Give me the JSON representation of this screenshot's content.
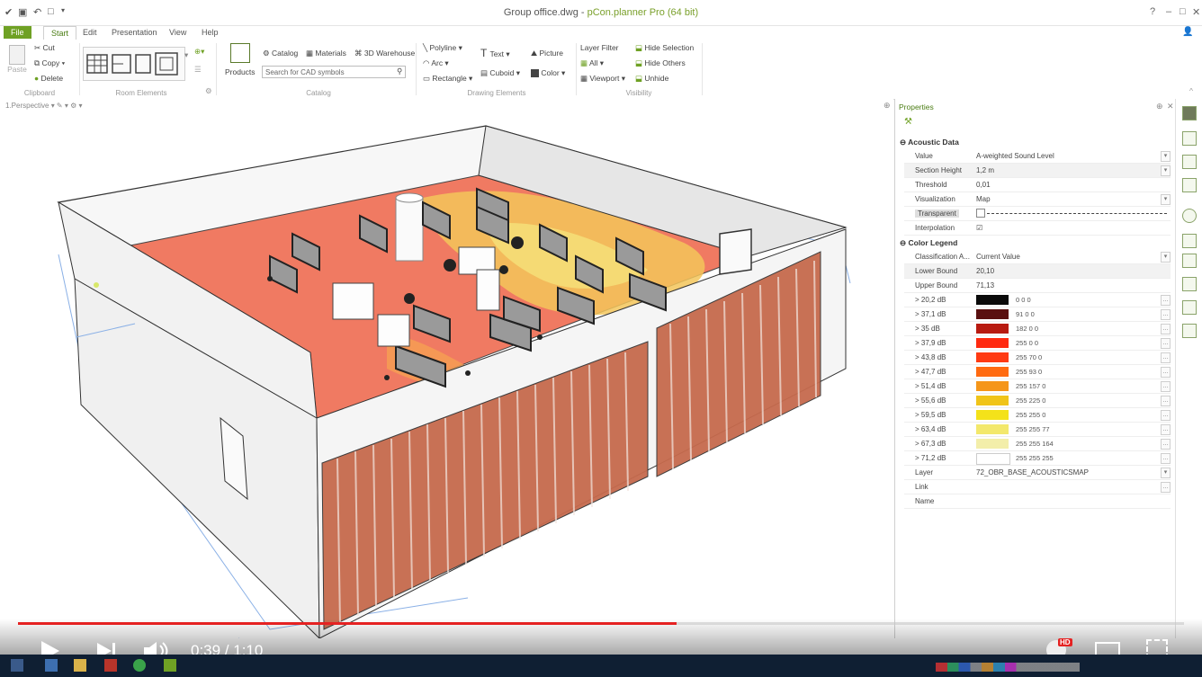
{
  "window": {
    "file_name": "Group office.dwg",
    "app_name": "pCon.planner Pro (64 bit)"
  },
  "tabs": [
    {
      "label": "File"
    },
    {
      "label": "Start"
    },
    {
      "label": "Edit"
    },
    {
      "label": "Presentation"
    },
    {
      "label": "View"
    },
    {
      "label": "Help"
    }
  ],
  "ribbon": {
    "clipboard": {
      "paste": "Paste",
      "cut": "Cut",
      "copy": "Copy",
      "delete": "Delete",
      "group": "Clipboard"
    },
    "room_elements": {
      "group": "Room Elements"
    },
    "catalog": {
      "products": "Products",
      "catalog": "Catalog",
      "materials": "Materials",
      "warehouse": "3D Warehouse",
      "search_placeholder": "Search for CAD symbols",
      "group": "Catalog"
    },
    "drawing": {
      "polyline": "Polyline",
      "arc": "Arc",
      "rectangle": "Rectangle",
      "text": "Text",
      "cuboid": "Cuboid",
      "picture": "Picture",
      "color": "Color",
      "group": "Drawing Elements"
    },
    "visibility": {
      "layer_filter": "Layer Filter",
      "all": "All",
      "viewport": "Viewport",
      "hide_selection": "Hide Selection",
      "hide_others": "Hide Others",
      "unhide": "Unhide",
      "group": "Visibility"
    }
  },
  "viewport": {
    "label": "1.Perspective"
  },
  "properties": {
    "title": "Properties",
    "acoustic_section": "Acoustic Data",
    "rows": [
      {
        "label": "Value",
        "value": "A-weighted Sound Level"
      },
      {
        "label": "Section Height",
        "value": "1,2 m"
      },
      {
        "label": "Threshold",
        "value": "0,01"
      },
      {
        "label": "Visualization",
        "value": "Map"
      },
      {
        "label": "Transparent",
        "value": ""
      },
      {
        "label": "Interpolation",
        "value": ""
      }
    ],
    "legend_section": "Color Legend",
    "legend_rows": [
      {
        "label": "Classification A...",
        "value": "Current Value"
      },
      {
        "label": "Lower Bound",
        "value": "20,10"
      },
      {
        "label": "Upper Bound",
        "value": "71,13"
      }
    ],
    "legend": [
      {
        "label": "> 20,2 dB",
        "color": "#0a0a0a",
        "rgb": "0 0 0"
      },
      {
        "label": "> 37,1 dB",
        "color": "#5a1010",
        "rgb": "91 0 0"
      },
      {
        "label": "> 35 dB",
        "color": "#b81a10",
        "rgb": "182 0 0"
      },
      {
        "label": "> 37,9 dB",
        "color": "#ff2a10",
        "rgb": "255 0 0"
      },
      {
        "label": "> 43,8 dB",
        "color": "#ff3a12",
        "rgb": "255 70 0"
      },
      {
        "label": "> 47,7 dB",
        "color": "#ff6a10",
        "rgb": "255 93 0"
      },
      {
        "label": "> 51,4 dB",
        "color": "#f5961a",
        "rgb": "255 157 0"
      },
      {
        "label": "> 55,6 dB",
        "color": "#f0c419",
        "rgb": "255 225 0"
      },
      {
        "label": "> 59,5 dB",
        "color": "#f4e21a",
        "rgb": "255 255 0"
      },
      {
        "label": "> 63,4 dB",
        "color": "#f3e86c",
        "rgb": "255 255 77"
      },
      {
        "label": "> 67,3 dB",
        "color": "#f3eeaa",
        "rgb": "255 255 164"
      },
      {
        "label": "> 71,2 dB",
        "color": "#ffffff",
        "rgb": "255 255 255"
      }
    ],
    "tail_rows": [
      {
        "label": "Layer",
        "value": "72_OBR_BASE_ACOUSTICSMAP"
      },
      {
        "label": "Link",
        "value": ""
      },
      {
        "label": "Name",
        "value": ""
      }
    ]
  },
  "video": {
    "time": "0:39 / 1:10",
    "hd_badge": "HD",
    "progress": 0.565
  },
  "colors": {
    "accent": "#6fa124",
    "floor": "#f07a62",
    "progress": "#e52222"
  }
}
